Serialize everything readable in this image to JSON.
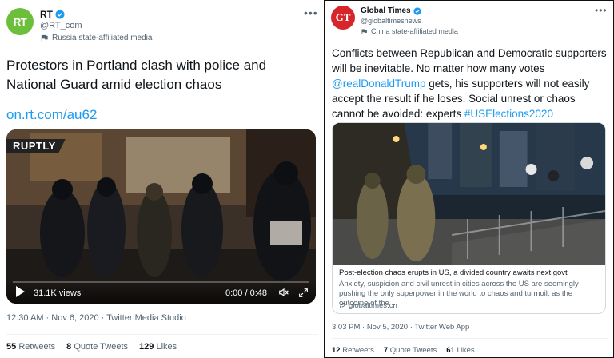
{
  "left_tweet": {
    "avatar_text": "RT",
    "name": "RT",
    "handle": "@RT_com",
    "label": "Russia state-affiliated media",
    "text": "Protestors in Portland clash with police and National Guard amid election chaos",
    "link": "on.rt.com/au62",
    "video": {
      "watermark": "RUPTLY",
      "views": "31.1K views",
      "time": "0:00 / 0:48"
    },
    "meta": "12:30 AM · Nov 6, 2020 · Twitter Media Studio",
    "stats": {
      "retweets_count": "55",
      "retweets_label": "Retweets",
      "quotes_count": "8",
      "quotes_label": "Quote Tweets",
      "likes_count": "129",
      "likes_label": "Likes"
    }
  },
  "right_tweet": {
    "avatar_text": "GT",
    "name": "Global Times",
    "handle": "@globaltimesnews",
    "label": "China state-affiliated media",
    "text_before_mention": "Conflicts between Republican and Democratic supporters will be inevitable. No matter how many votes ",
    "mention": "@realDonaldTrump",
    "text_after_mention": " gets, his supporters will not easily accept the result if he loses. Social unrest or chaos cannot be avoided: experts ",
    "hashtag": "#USElections2020",
    "card": {
      "title": "Post-election chaos erupts in US, a divided country awaits next govt",
      "description": "Anxiety, suspicion and civil unrest in cities across the US are seemingly pushing the only superpower in the world to chaos and turmoil, as the outcome of the ...",
      "domain": "globaltimes.cn"
    },
    "meta": "3:03 PM · Nov 5, 2020 · Twitter Web App",
    "stats": {
      "retweets_count": "12",
      "retweets_label": "Retweets",
      "quotes_count": "7",
      "quotes_label": "Quote Tweets",
      "likes_count": "61",
      "likes_label": "Likes"
    }
  },
  "colors": {
    "link": "#1d9bf0",
    "rt_brand": "#6bbf3a",
    "gt_brand": "#d7262b",
    "secondary_text": "#536471"
  },
  "icons": [
    "verified-icon",
    "state-media-flag-icon",
    "more-icon",
    "play-icon",
    "volume-icon",
    "expand-icon",
    "link-icon"
  ]
}
